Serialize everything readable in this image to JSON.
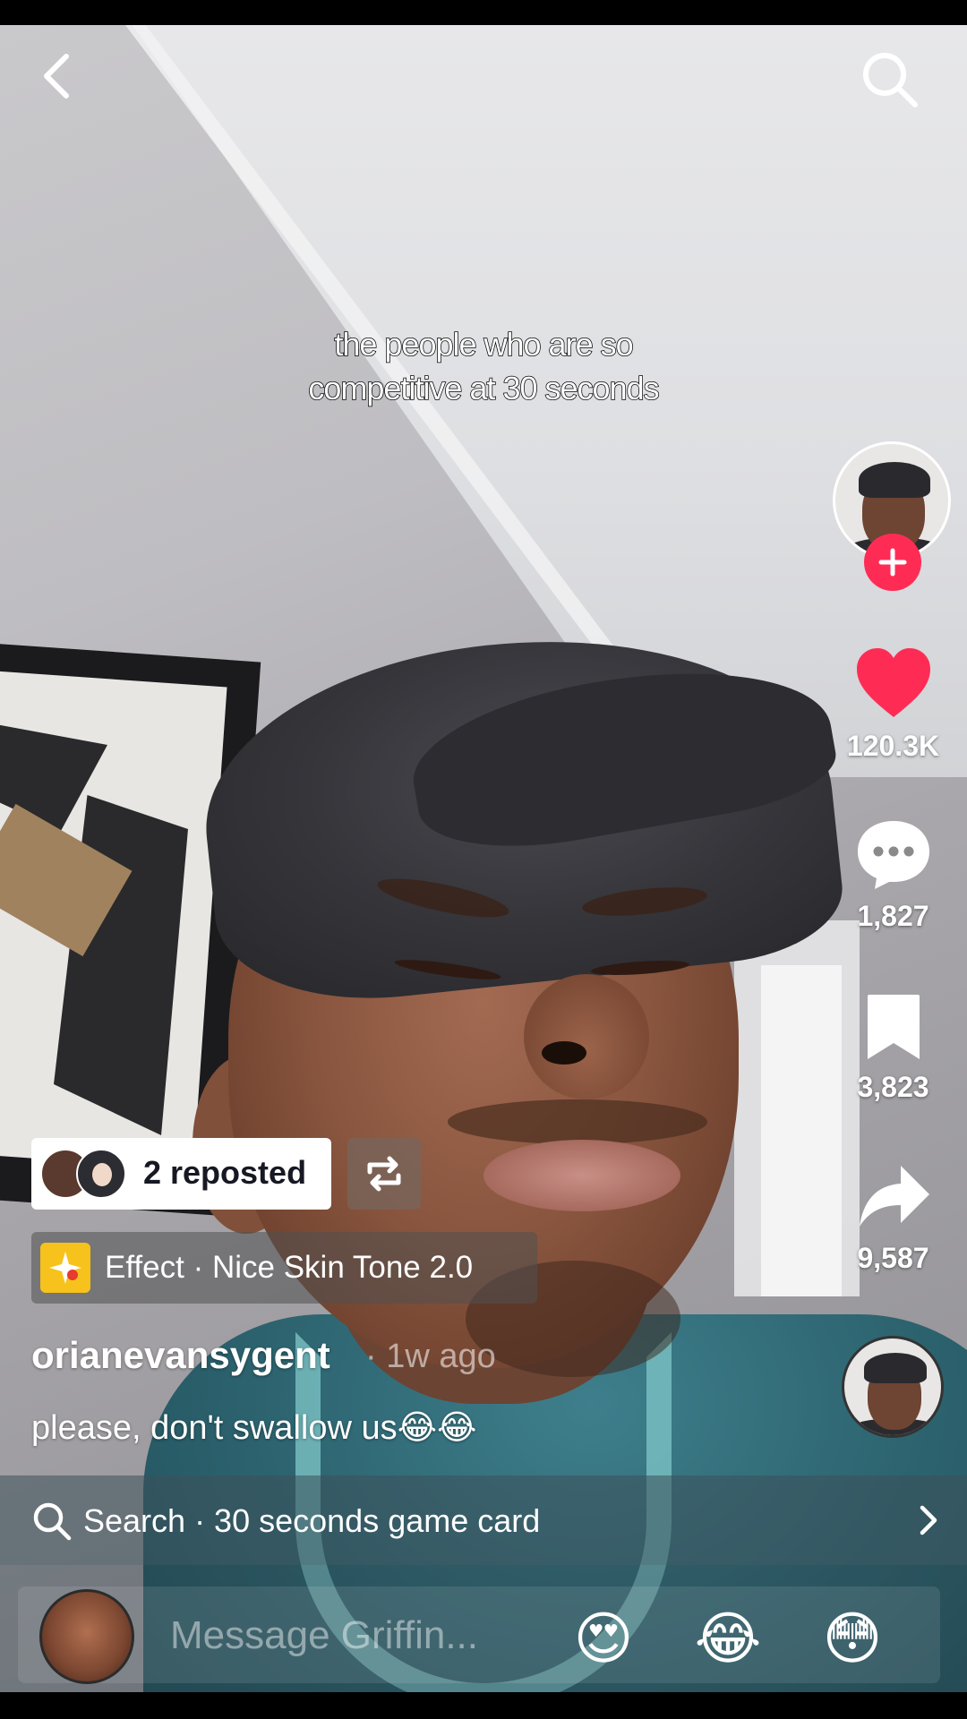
{
  "video": {
    "caption": "the people who are so competitive at 30 seconds"
  },
  "icons": {
    "back": "chevron-left-icon",
    "search": "search-icon",
    "like": "heart-icon",
    "comment": "comment-bubble-icon",
    "save": "bookmark-icon",
    "share": "share-arrow-icon",
    "follow": "plus-icon",
    "repost": "repost-icon",
    "effect": "sparkle-icon"
  },
  "actions": {
    "likes": "120.3K",
    "comments": "1,827",
    "saves": "3,823",
    "shares": "9,587"
  },
  "repost": {
    "label": "2 reposted"
  },
  "effect": {
    "label": "Effect · Nice Skin Tone 2.0"
  },
  "post": {
    "username": "orianevansygent",
    "time": "· 1w ago",
    "description": "please, don't swallow us😂😂"
  },
  "search_suggestion": {
    "label": "Search · 30 seconds game card"
  },
  "message": {
    "placeholder": "Message Griffin...",
    "quick_emojis": [
      "😍",
      "😂",
      "😳"
    ]
  },
  "colors": {
    "like_red": "#fe2c55",
    "effect_yellow": "#f7c21b"
  }
}
